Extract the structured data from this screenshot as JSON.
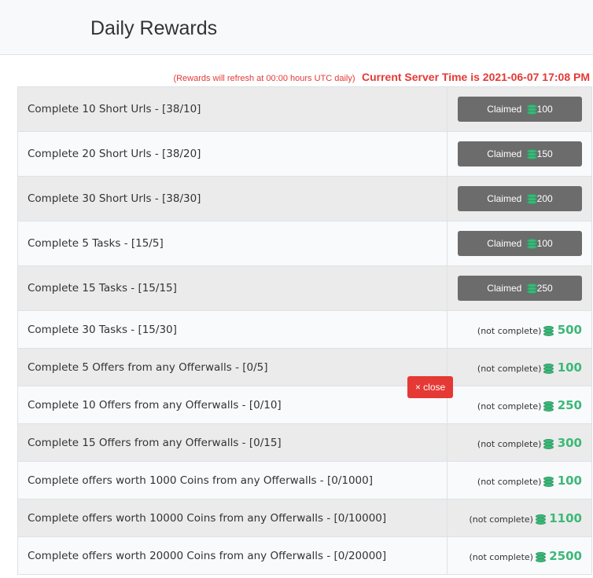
{
  "header": {
    "title": "Daily Rewards"
  },
  "info": {
    "refresh_note": "(Rewards will refresh at 00:00 hours UTC daily)",
    "server_time": "Current Server Time is 2021-06-07 17:08 PM"
  },
  "close_button": {
    "label": "× close"
  },
  "rewards": [
    {
      "task": "Complete 10 Short Urls - [38/10]",
      "claimed": true,
      "claimed_label": "Claimed",
      "amount": "100"
    },
    {
      "task": "Complete 20 Short Urls - [38/20]",
      "claimed": true,
      "claimed_label": "Claimed",
      "amount": "150"
    },
    {
      "task": "Complete 30 Short Urls - [38/30]",
      "claimed": true,
      "claimed_label": "Claimed",
      "amount": "200"
    },
    {
      "task": "Complete 5 Tasks - [15/5]",
      "claimed": true,
      "claimed_label": "Claimed",
      "amount": "100"
    },
    {
      "task": "Complete 15 Tasks - [15/15]",
      "claimed": true,
      "claimed_label": "Claimed",
      "amount": "250"
    },
    {
      "task": "Complete 30 Tasks - [15/30]",
      "claimed": false,
      "status": "(not complete)",
      "amount": "500"
    },
    {
      "task": "Complete 5 Offers from any Offerwalls - [0/5]",
      "claimed": false,
      "status": "(not complete)",
      "amount": "100"
    },
    {
      "task": "Complete 10 Offers from any Offerwalls - [0/10]",
      "claimed": false,
      "status": "(not complete)",
      "amount": "250"
    },
    {
      "task": "Complete 15 Offers from any Offerwalls - [0/15]",
      "claimed": false,
      "status": "(not complete)",
      "amount": "300"
    },
    {
      "task": "Complete offers worth 1000 Coins from any Offerwalls - [0/1000]",
      "claimed": false,
      "status": "(not complete)",
      "amount": "100"
    },
    {
      "task": "Complete offers worth 10000 Coins from any Offerwalls - [0/10000]",
      "claimed": false,
      "status": "(not complete)",
      "amount": "1100"
    },
    {
      "task": "Complete offers worth 20000 Coins from any Offerwalls - [0/20000]",
      "claimed": false,
      "status": "(not complete)",
      "amount": "2500"
    }
  ],
  "icons": {
    "coin": "coins-icon",
    "close": "close-icon"
  },
  "colors": {
    "accent_red": "#e53935",
    "reward_green": "#3cb878",
    "claimed_gray": "#6c6c6c"
  }
}
